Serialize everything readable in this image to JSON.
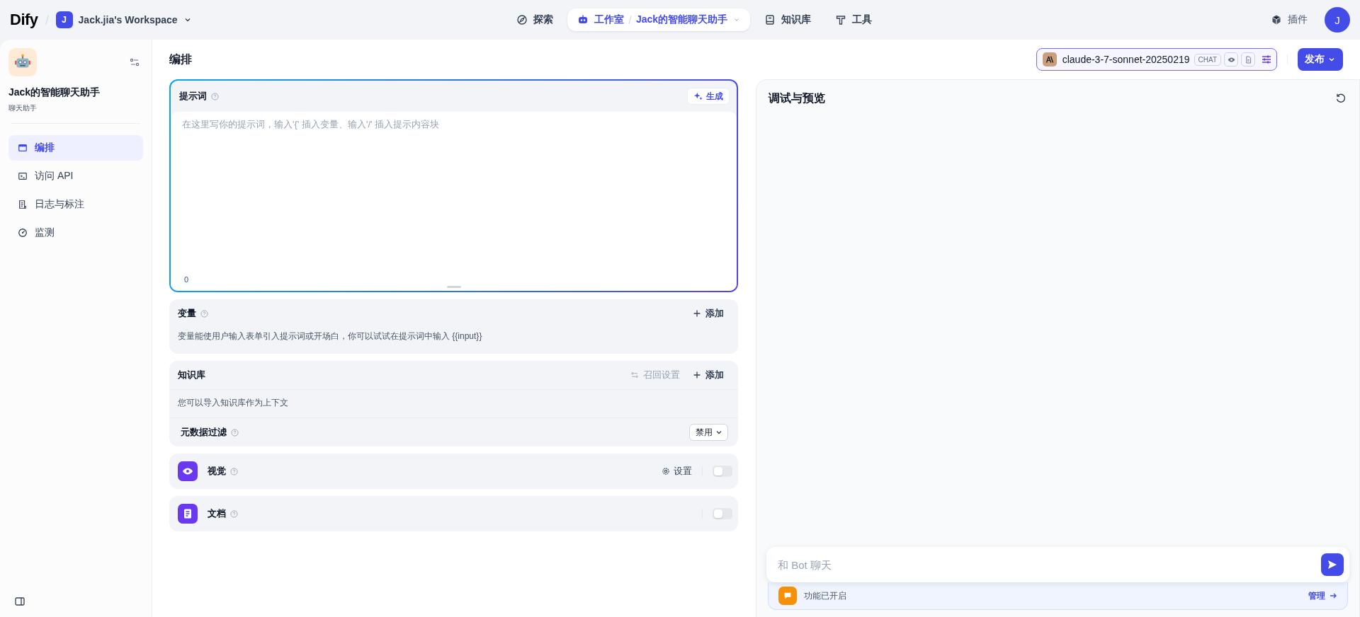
{
  "top_nav": {
    "logo": "Dify",
    "workspace": {
      "avatar": "J",
      "name": "Jack.jia's Workspace"
    },
    "nav_items": [
      {
        "kind": "explore",
        "label": "探索",
        "selected": false
      },
      {
        "kind": "studio",
        "label": "工作室",
        "selected": true,
        "app": "Jack的智能聊天助手"
      },
      {
        "kind": "knowledge",
        "label": "知识库",
        "selected": false
      },
      {
        "kind": "tools",
        "label": "工具",
        "selected": false
      }
    ],
    "plugins": "插件",
    "user_avatar": "J"
  },
  "sidebar": {
    "app_name": "Jack的智能聊天助手",
    "app_type": "聊天助手",
    "items": [
      {
        "kind": "orchestrate",
        "label": "编排",
        "selected": true
      },
      {
        "kind": "api",
        "label": "访问 API",
        "selected": false
      },
      {
        "kind": "logs",
        "label": "日志与标注",
        "selected": false
      },
      {
        "kind": "monitor",
        "label": "监测",
        "selected": false
      }
    ]
  },
  "header": {
    "title": "编排",
    "model": {
      "name": "claude-3-7-sonnet-20250219",
      "mode": "CHAT"
    },
    "publish": "发布"
  },
  "prompt": {
    "title": "提示词",
    "generate": "生成",
    "placeholder": "在这里写你的提示词，输入'{' 插入变量、输入'/' 插入提示内容块",
    "char_count": "0"
  },
  "variables": {
    "title": "变量",
    "add": "添加",
    "hint": "变量能使用户输入表单引入提示词或开场白，你可以试试在提示词中输入 {{input}}"
  },
  "knowledge": {
    "title": "知识库",
    "recall": {
      "label": "召回设置",
      "disabled": true
    },
    "add": "添加",
    "hint": "您可以导入知识库作为上下文",
    "metadata_filter": {
      "label": "元数据过滤",
      "value": "禁用"
    }
  },
  "features": [
    {
      "kind": "vision",
      "title": "视觉",
      "settings": "设置",
      "on": false
    },
    {
      "kind": "document",
      "title": "文档",
      "on": false
    }
  ],
  "debug": {
    "title": "调试与预览",
    "chat_placeholder": "和 Bot 聊天",
    "features_banner": "功能已开启",
    "manage": "管理"
  }
}
